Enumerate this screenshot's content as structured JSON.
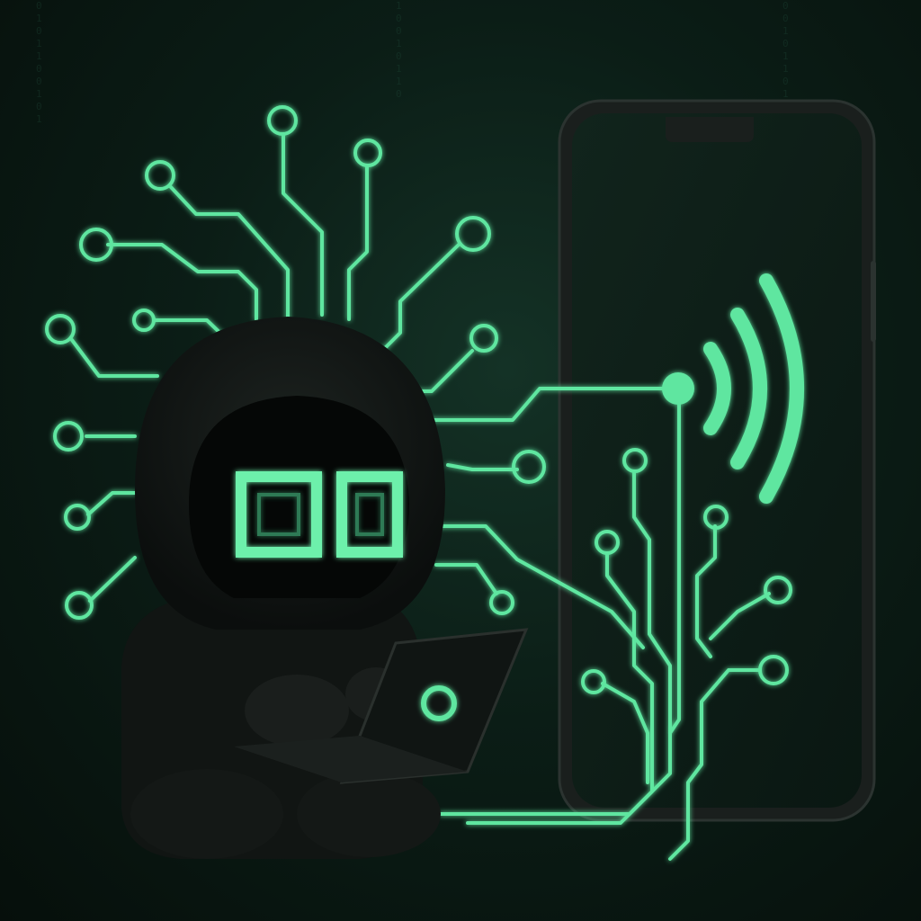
{
  "scene": {
    "description_icons": [
      "hooded-hacker",
      "laptop",
      "smartphone",
      "wifi-signal-icon",
      "circuit-traces"
    ],
    "colors": {
      "background": "#0b1d16",
      "glow_green": "#5ee6a0",
      "figure_dark": "#121614",
      "phone_body": "#0e1613"
    }
  }
}
